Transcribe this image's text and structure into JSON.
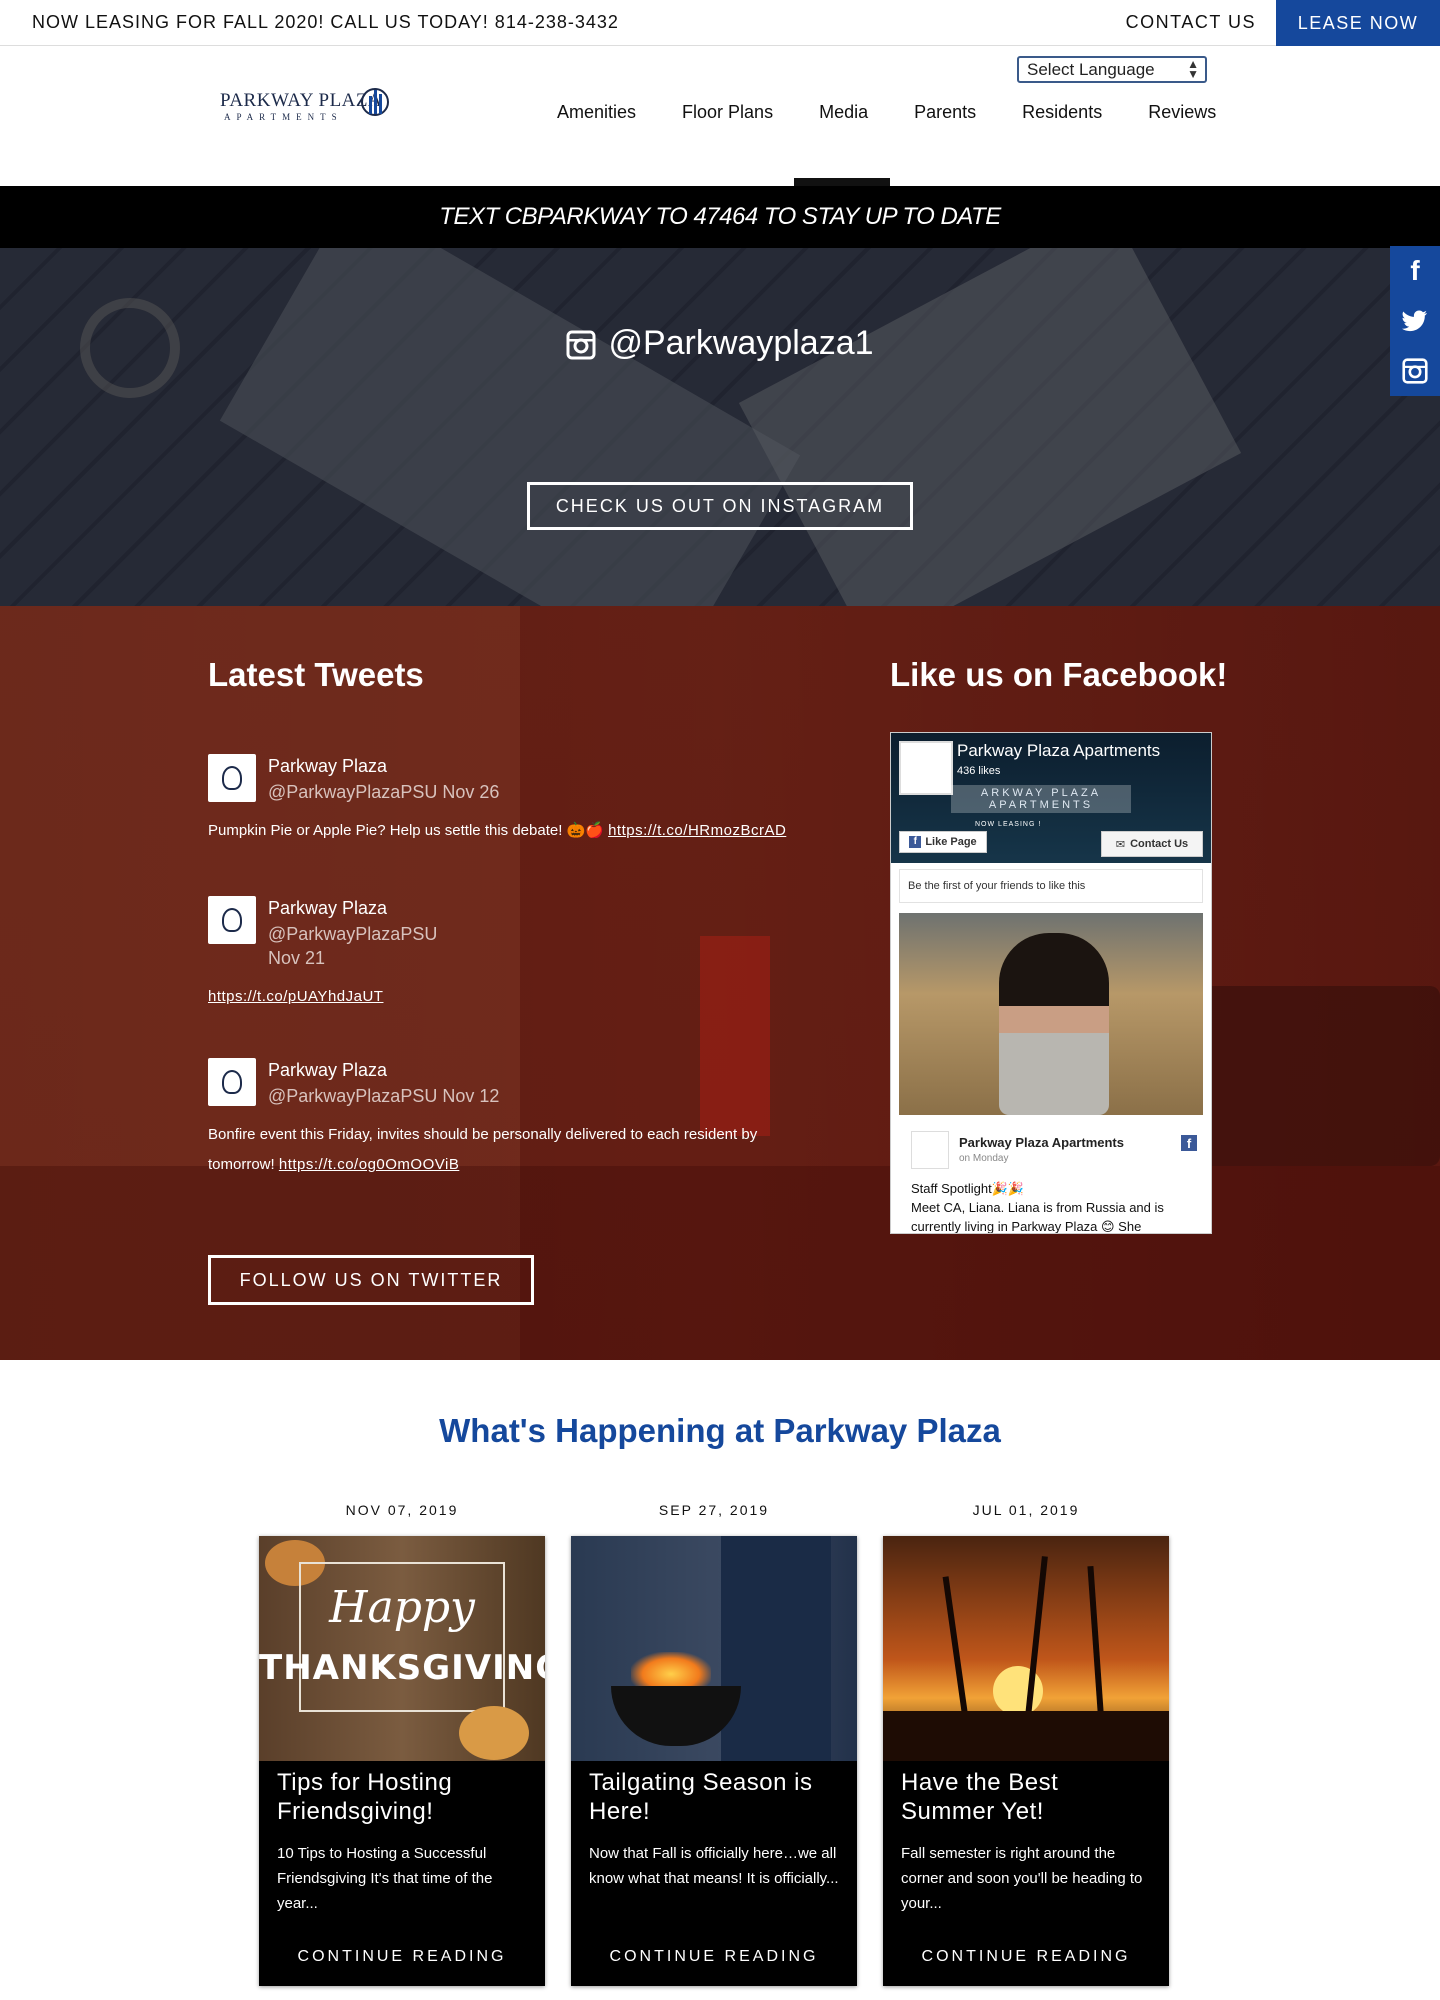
{
  "topbar": {
    "announcement": "NOW LEASING FOR FALL 2020! CALL US TODAY! 814-238-3432",
    "contact_label": "CONTACT US",
    "lease_label": "LEASE NOW"
  },
  "header": {
    "language_select": "Select Language",
    "logo_name": "PARKWAY PLAZA",
    "logo_sub": "APARTMENTS",
    "nav": [
      "Amenities",
      "Floor Plans",
      "Media",
      "Parents",
      "Residents",
      "Reviews"
    ],
    "active_nav": "Media"
  },
  "text_banner": "TEXT CBPARKWAY TO 47464 TO STAY UP TO DATE",
  "instagram": {
    "handle": "@Parkwayplaza1",
    "button": "CHECK US OUT ON INSTAGRAM"
  },
  "social_icons": [
    "facebook-icon",
    "twitter-icon",
    "instagram-icon"
  ],
  "tweets_section": {
    "title": "Latest Tweets",
    "tweets": [
      {
        "user": "Parkway Plaza",
        "handle_date": "@ParkwayPlazaPSU Nov 26",
        "text": "Pumpkin Pie or Apple Pie? Help us settle this debate! 🎃🍎",
        "link": "https://t.co/HRmozBcrAD"
      },
      {
        "user": "Parkway Plaza",
        "handle": "@ParkwayPlazaPSU",
        "date": "Nov 21",
        "text": "",
        "link": "https://t.co/pUAYhdJaUT"
      },
      {
        "user": "Parkway Plaza",
        "handle_date": "@ParkwayPlazaPSU Nov 12",
        "text_line1": "Bonfire event this Friday, invites should be personally delivered to each resident by",
        "text_line2": "tomorrow!",
        "link": "https://t.co/og0OmOOViB"
      }
    ],
    "follow_button": "FOLLOW US ON TWITTER"
  },
  "facebook_section": {
    "title": "Like us on Facebook!",
    "page_name": "Parkway Plaza Apartments",
    "likes": "436 likes",
    "cover_banner": "ARKWAY PLAZA APARTMENTS",
    "cover_leasing": "NOW LEASING !",
    "like_button": "Like Page",
    "contact_button": "Contact Us",
    "friends_text": "Be the first of your friends to like this",
    "post_page_name": "Parkway Plaza Apartments",
    "post_when": "on Monday",
    "post_line1": "Staff Spotlight🎉🎉",
    "post_line2": "Meet CA, Liana. Liana is from Russia and is",
    "post_line3": "currently living in Parkway Plaza 😊 She"
  },
  "blog": {
    "title": "What's Happening at Parkway Plaza",
    "posts": [
      {
        "date": "NOV 07, 2019",
        "title": "Tips for Hosting Friendsgiving!",
        "excerpt": "10 Tips to Hosting a Successful Friendsgiving  It's that time of the year...",
        "more": "CONTINUE READING",
        "image_text_1": "Happy",
        "image_text_2": "THANKSGIVING"
      },
      {
        "date": "SEP 27, 2019",
        "title": "Tailgating Season is Here!",
        "excerpt": "Now that Fall is officially here…we all know what that means! It is officially...",
        "more": "CONTINUE READING"
      },
      {
        "date": "JUL 01, 2019",
        "title": "Have the Best Summer Yet!",
        "excerpt": "Fall semester is right around the corner and soon you'll be heading to your...",
        "more": "CONTINUE READING"
      }
    ]
  },
  "colors": {
    "brand_blue": "#15489c",
    "banner_black": "#000000",
    "social_overlay": "#5f140c"
  }
}
